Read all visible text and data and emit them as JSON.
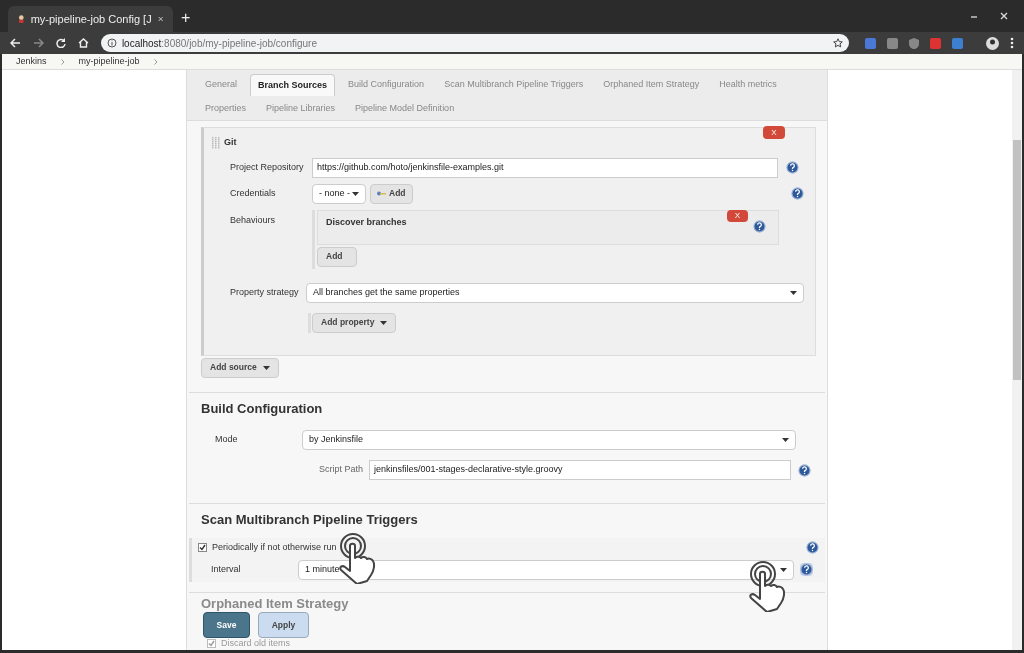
{
  "browser": {
    "tab_title": "my-pipeline-job Config [J",
    "new_tab": "+",
    "address_host": "localhost",
    "address_path": ":8080/job/my-pipeline-job/configure"
  },
  "breadcrumbs": [
    "Jenkins",
    "my-pipeline-job"
  ],
  "tabs": [
    {
      "label": "General",
      "selected": false
    },
    {
      "label": "Branch Sources",
      "selected": true
    },
    {
      "label": "Build Configuration",
      "selected": false
    },
    {
      "label": "Scan Multibranch Pipeline Triggers",
      "selected": false
    },
    {
      "label": "Orphaned Item Strategy",
      "selected": false
    },
    {
      "label": "Health metrics",
      "selected": false
    },
    {
      "label": "Properties",
      "selected": false
    },
    {
      "label": "Pipeline Libraries",
      "selected": false
    },
    {
      "label": "Pipeline Model Definition",
      "selected": false
    }
  ],
  "git_source": {
    "title": "Git",
    "delete": "X",
    "repository_label": "Project Repository",
    "repository": "https://github.com/hoto/jenkinsfile-examples.git",
    "credentials_label": "Credentials",
    "credentials": "- none -",
    "credentials_add": "Add",
    "behaviours_label": "Behaviours",
    "behaviour": {
      "title": "Discover branches",
      "delete": "X"
    },
    "behaviour_add": "Add",
    "property_strategy_label": "Property strategy",
    "property_strategy": "All branches get the same properties",
    "add_property": "Add property"
  },
  "add_source": "Add source",
  "build_configuration": {
    "heading": "Build Configuration",
    "mode_label": "Mode",
    "mode": "by Jenkinsfile",
    "script_path_label": "Script Path",
    "script_path": "jenkinsfiles/001-stages-declarative-style.groovy"
  },
  "triggers": {
    "heading": "Scan Multibranch Pipeline Triggers",
    "periodic_label": "Periodically if not otherwise run",
    "periodic_checked": true,
    "interval_label": "Interval",
    "interval": "1 minute"
  },
  "orphaned": {
    "heading": "Orphaned Item Strategy",
    "discard_label": "Discard old items",
    "discard_checked": true
  },
  "buttons": {
    "save": "Save",
    "apply": "Apply"
  }
}
